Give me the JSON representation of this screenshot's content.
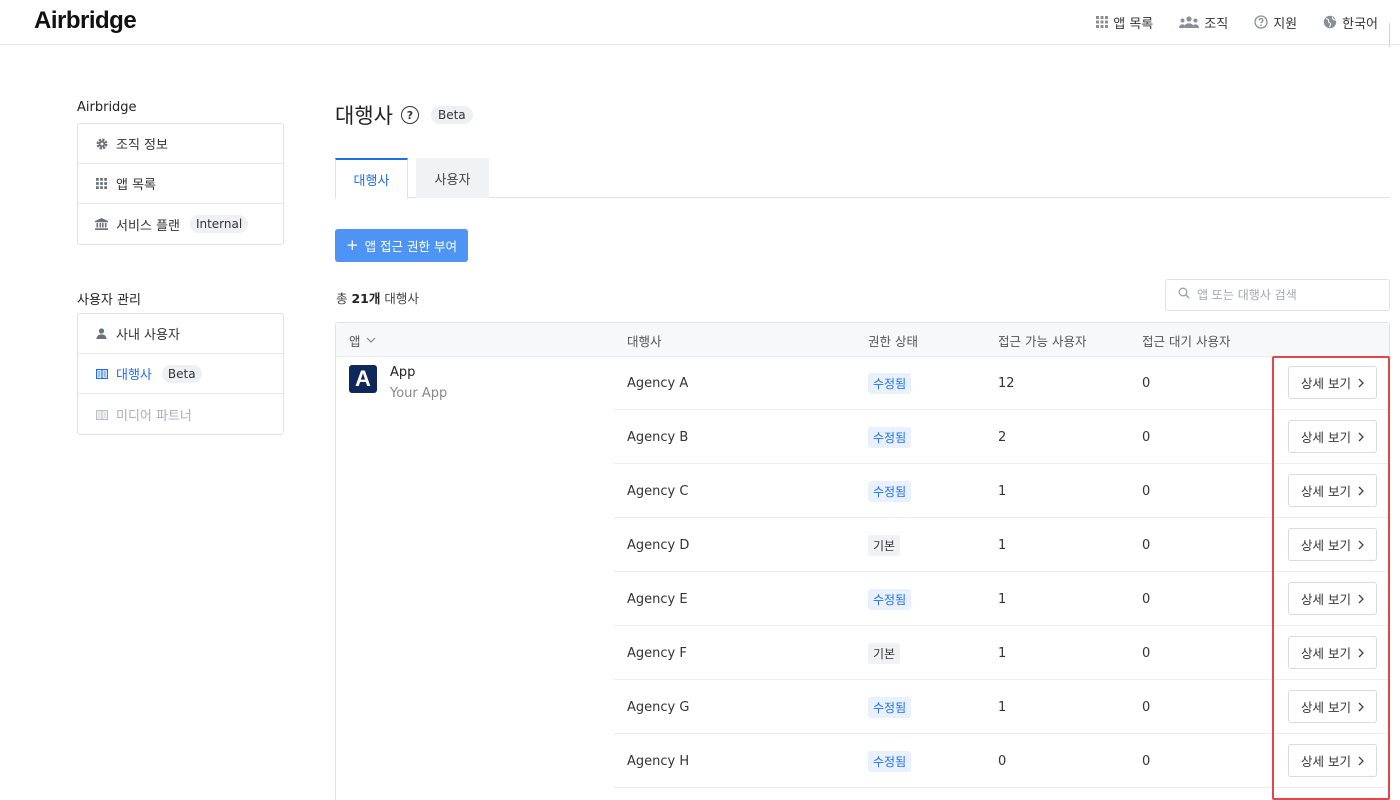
{
  "app_title": "Airbridge",
  "topnav": [
    {
      "label": "앱 목록",
      "icon": "grid-icon"
    },
    {
      "label": "조직",
      "icon": "people-icon"
    },
    {
      "label": "지원",
      "icon": "help-circle-icon"
    },
    {
      "label": "한국어",
      "icon": "globe-icon"
    }
  ],
  "sidebar": {
    "section1_title": "Airbridge",
    "section1_items": [
      {
        "label": "조직 정보",
        "icon": "gear-icon"
      },
      {
        "label": "앱 목록",
        "icon": "grid-icon"
      },
      {
        "label": "서비스 플랜",
        "icon": "bank-icon",
        "tag": "Internal"
      }
    ],
    "section2_title": "사용자 관리",
    "section2_items": [
      {
        "label": "사내 사용자",
        "icon": "user-icon"
      },
      {
        "label": "대행사",
        "icon": "building-icon",
        "tag": "Beta",
        "active": true
      },
      {
        "label": "미디어 파트너",
        "icon": "building-icon",
        "disabled": true
      }
    ]
  },
  "page": {
    "title": "대행사",
    "badge": "Beta",
    "tabs": [
      "대행사",
      "사용자"
    ],
    "add_button": "앱 접근 권한 부여",
    "total_prefix": "총 ",
    "total_count": "21개",
    "total_suffix": " 대행사",
    "search_placeholder": "앱 또는 대행사 검색"
  },
  "table": {
    "headers": [
      "앱",
      "대행사",
      "권한 상태",
      "접근 가능 사용자",
      "접근 대기 사용자"
    ],
    "app": {
      "name": "App",
      "subtitle": "Your App",
      "logo_letter": "A"
    },
    "detail_label": "상세 보기",
    "rows": [
      {
        "agency": "Agency A",
        "status": "수정됨",
        "status_type": "mod",
        "accessible": "12",
        "pending": "0"
      },
      {
        "agency": "Agency B",
        "status": "수정됨",
        "status_type": "mod",
        "accessible": "2",
        "pending": "0"
      },
      {
        "agency": "Agency C",
        "status": "수정됨",
        "status_type": "mod",
        "accessible": "1",
        "pending": "0"
      },
      {
        "agency": "Agency D",
        "status": "기본",
        "status_type": "def",
        "accessible": "1",
        "pending": "0"
      },
      {
        "agency": "Agency E",
        "status": "수정됨",
        "status_type": "mod",
        "accessible": "1",
        "pending": "0"
      },
      {
        "agency": "Agency F",
        "status": "기본",
        "status_type": "def",
        "accessible": "1",
        "pending": "0"
      },
      {
        "agency": "Agency G",
        "status": "수정됨",
        "status_type": "mod",
        "accessible": "1",
        "pending": "0"
      },
      {
        "agency": "Agency H",
        "status": "수정됨",
        "status_type": "mod",
        "accessible": "0",
        "pending": "0"
      }
    ]
  },
  "colors": {
    "accent": "#1f6feb",
    "button": "#4d94f5",
    "highlight": "#e0464b",
    "app_logo": "#10275a"
  }
}
